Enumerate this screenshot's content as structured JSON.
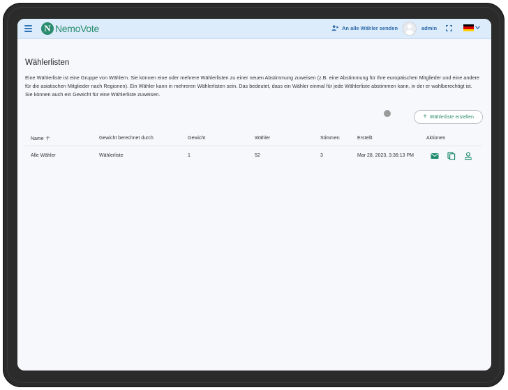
{
  "app": {
    "logo_letter": "N",
    "logo_text": "NemoVote",
    "brand_color": "#2a8c6e",
    "header_bg": "#dcecfb",
    "link_color": "#2f6aa8"
  },
  "header": {
    "menu_icon": "hamburger-menu-icon",
    "send_all_label": "An alle Wähler senden",
    "send_all_icon": "people-send-icon",
    "username": "admin",
    "fullscreen_icon": "fullscreen-icon",
    "language_flag": "germany-flag-icon",
    "language_chevron": "chevron-down-icon"
  },
  "page": {
    "title": "Wählerlisten",
    "description": "Eine Wählerliste ist eine Gruppe von Wählern. Sie können eine oder mehrere Wählerlisten zu einer neuen Abstimmung zuweisen (z.B. eine Abstimmung für Ihre europäischen Mitglieder und eine andere für die asiatischen Mitglieder nach Regionen). Ein Wähler kann in mehreren Wählerlisten sein. Das bedeutet, dass ein Wähler einmal für jede Wählerliste abstimmen kann, in der er wahlberechtigt ist. Sie können auch ein Gewicht für eine Wählerliste zuweisen.",
    "create_button_label": "Wählerliste erstellen",
    "create_button_icon": "plus-icon"
  },
  "table": {
    "columns": {
      "name": "Name",
      "weight_by": "Gewicht berechnet durch",
      "weight": "Gewicht",
      "voters": "Wähler",
      "votes": "Stimmen",
      "created": "Erstellt",
      "actions": "Aktionen"
    },
    "sort_icon": "arrow-up-icon",
    "rows": [
      {
        "name": "Alle Wähler",
        "weight_by": "Wählerliste",
        "weight": "1",
        "voters": "52",
        "votes": "3",
        "created": "Mar 28, 2023, 3:36:13 PM",
        "action_icons": [
          "envelope-icon",
          "copy-icon",
          "person-upload-icon"
        ]
      }
    ]
  }
}
